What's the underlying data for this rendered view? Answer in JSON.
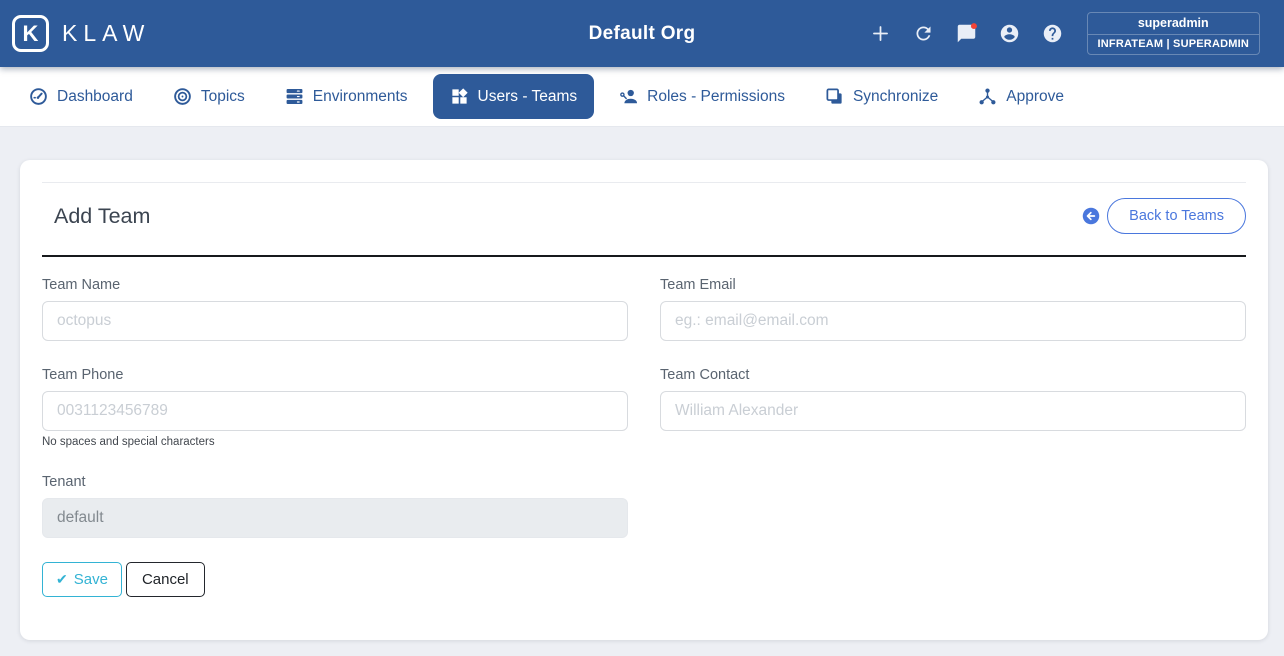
{
  "app": {
    "logo_letter": "K",
    "logo_word": "KLAW"
  },
  "header": {
    "org_title": "Default Org",
    "action_icons": [
      "plus-icon",
      "refresh-icon",
      "chat-icon",
      "account-icon",
      "help-icon"
    ],
    "user": {
      "username": "superadmin",
      "team_role": "INFRATEAM | SUPERADMIN"
    }
  },
  "nav": {
    "items": [
      {
        "label": "Dashboard",
        "icon": "gauge-icon",
        "active": false
      },
      {
        "label": "Topics",
        "icon": "bullseye-icon",
        "active": false
      },
      {
        "label": "Environments",
        "icon": "server-icon",
        "active": false
      },
      {
        "label": "Users - Teams",
        "icon": "widgets-icon",
        "active": true
      },
      {
        "label": "Roles - Permissions",
        "icon": "user-key-icon",
        "active": false
      },
      {
        "label": "Synchronize",
        "icon": "clone-icon",
        "active": false
      },
      {
        "label": "Approve",
        "icon": "hub-icon",
        "active": false
      }
    ]
  },
  "main": {
    "title": "Add Team",
    "back_button_label": "Back to Teams",
    "form": {
      "team_name": {
        "label": "Team Name",
        "placeholder": "octopus"
      },
      "team_email": {
        "label": "Team Email",
        "placeholder": "eg.: email@email.com"
      },
      "team_phone": {
        "label": "Team Phone",
        "placeholder": "0031123456789",
        "helper": "No spaces and special characters"
      },
      "team_contact": {
        "label": "Team Contact",
        "placeholder": "William Alexander"
      },
      "tenant": {
        "label": "Tenant",
        "value": "default",
        "disabled": true
      }
    },
    "save_label": "Save",
    "cancel_label": "Cancel",
    "check_glyph": "✔"
  },
  "colors": {
    "header_bg": "#2e5a99",
    "nav_link_blue": "#2e5a99",
    "nav_active_bg": "#2e5a99",
    "back_accent_blue": "#4a77dd",
    "save_teal": "#33b3d4",
    "badge_red": "#f44336",
    "page_bg": "#edeff4",
    "dark_rule": "#17191c"
  }
}
